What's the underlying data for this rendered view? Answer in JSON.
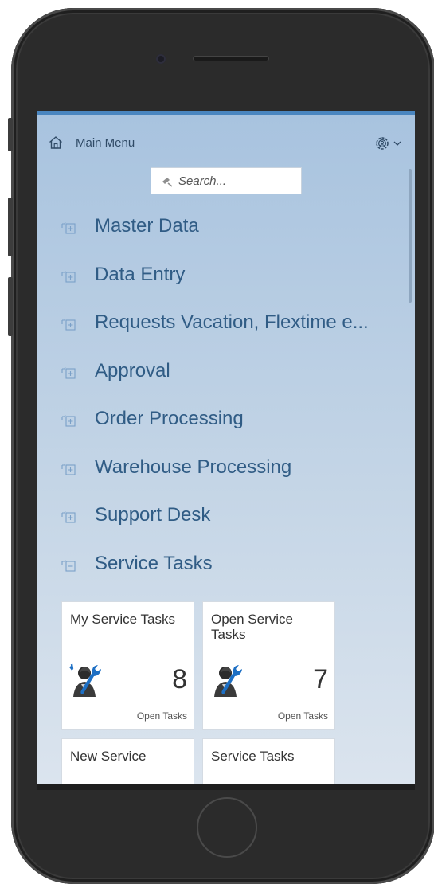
{
  "header": {
    "title": "Main Menu",
    "home_icon": "home-icon",
    "settings_icon": "gear-user-icon",
    "settings_chevron": "chevron-down-icon"
  },
  "search": {
    "placeholder": "Search...",
    "value": ""
  },
  "menu": {
    "items": [
      {
        "label": "Master Data",
        "icon": "expand-folder-icon"
      },
      {
        "label": "Data Entry",
        "icon": "expand-folder-icon"
      },
      {
        "label": "Requests Vacation, Flextime e...",
        "icon": "expand-folder-icon"
      },
      {
        "label": "Approval",
        "icon": "expand-folder-icon"
      },
      {
        "label": "Order Processing",
        "icon": "expand-folder-icon"
      },
      {
        "label": "Warehouse Processing",
        "icon": "expand-folder-icon"
      },
      {
        "label": "Support Desk",
        "icon": "expand-folder-icon"
      },
      {
        "label": "Service Tasks",
        "icon": "collapse-folder-icon"
      }
    ]
  },
  "tiles": [
    {
      "title": "My Service Tasks",
      "count": "8",
      "unit": "Open Tasks",
      "icon": "service-technician-icon"
    },
    {
      "title": "Open Service Tasks",
      "count": "7",
      "unit": "Open Tasks",
      "icon": "service-technician-icon"
    },
    {
      "title": "New Service",
      "count": "",
      "unit": "",
      "icon": ""
    },
    {
      "title": "Service Tasks",
      "count": "",
      "unit": "",
      "icon": ""
    }
  ],
  "colors": {
    "accent": "#4a86c0",
    "menu_text": "#305c85",
    "icon_blue": "#1d6fc4"
  }
}
